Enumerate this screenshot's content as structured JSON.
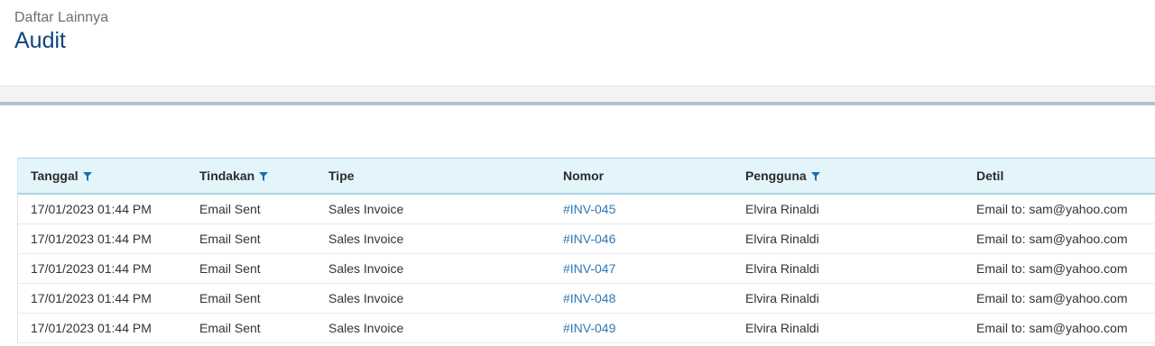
{
  "header": {
    "breadcrumb": "Daftar Lainnya",
    "title": "Audit"
  },
  "colors": {
    "title": "#12447c",
    "link": "#2f78b5",
    "header_bg": "#e4f4fb",
    "filter_icon": "#1f6fa8"
  },
  "table": {
    "columns": [
      {
        "label": "Tanggal",
        "filter": true
      },
      {
        "label": "Tindakan",
        "filter": true
      },
      {
        "label": "Tipe",
        "filter": false
      },
      {
        "label": "Nomor",
        "filter": false
      },
      {
        "label": "Pengguna",
        "filter": true
      },
      {
        "label": "Detil",
        "filter": false
      }
    ],
    "rows": [
      {
        "tanggal": "17/01/2023 01:44 PM",
        "tindakan": "Email Sent",
        "tipe": "Sales Invoice",
        "nomor": "#INV-045",
        "pengguna": "Elvira Rinaldi",
        "detil": "Email to: sam@yahoo.com"
      },
      {
        "tanggal": "17/01/2023 01:44 PM",
        "tindakan": "Email Sent",
        "tipe": "Sales Invoice",
        "nomor": "#INV-046",
        "pengguna": "Elvira Rinaldi",
        "detil": "Email to: sam@yahoo.com"
      },
      {
        "tanggal": "17/01/2023 01:44 PM",
        "tindakan": "Email Sent",
        "tipe": "Sales Invoice",
        "nomor": "#INV-047",
        "pengguna": "Elvira Rinaldi",
        "detil": "Email to: sam@yahoo.com"
      },
      {
        "tanggal": "17/01/2023 01:44 PM",
        "tindakan": "Email Sent",
        "tipe": "Sales Invoice",
        "nomor": "#INV-048",
        "pengguna": "Elvira Rinaldi",
        "detil": "Email to: sam@yahoo.com"
      },
      {
        "tanggal": "17/01/2023 01:44 PM",
        "tindakan": "Email Sent",
        "tipe": "Sales Invoice",
        "nomor": "#INV-049",
        "pengguna": "Elvira Rinaldi",
        "detil": "Email to: sam@yahoo.com"
      }
    ]
  }
}
